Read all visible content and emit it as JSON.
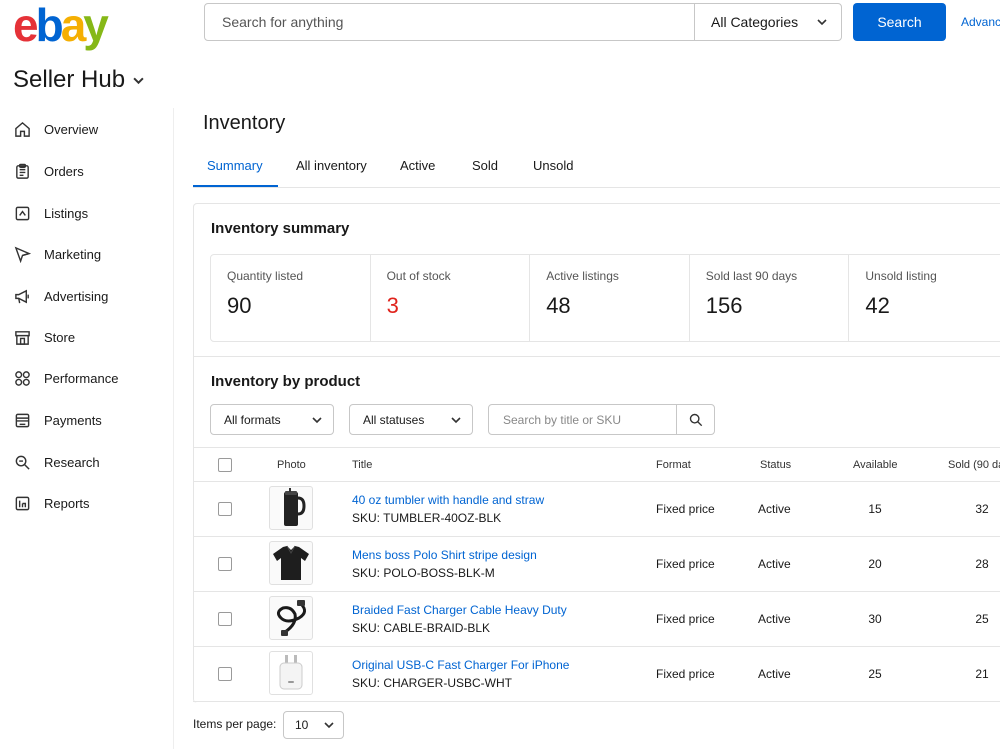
{
  "header": {
    "logo": [
      "e",
      "b",
      "a",
      "y"
    ],
    "search_placeholder": "Search for anything",
    "category": "All Categories",
    "search_button": "Search",
    "advanced": "Advanc"
  },
  "hub": {
    "title": "Seller Hub"
  },
  "sidebar": {
    "items": [
      {
        "label": "Overview",
        "icon": "home-icon"
      },
      {
        "label": "Orders",
        "icon": "clipboard-icon"
      },
      {
        "label": "Listings",
        "icon": "listings-icon"
      },
      {
        "label": "Marketing",
        "icon": "send-icon"
      },
      {
        "label": "Advertising",
        "icon": "megaphone-icon"
      },
      {
        "label": "Store",
        "icon": "store-icon"
      },
      {
        "label": "Performance",
        "icon": "grid-icon"
      },
      {
        "label": "Payments",
        "icon": "payments-icon"
      },
      {
        "label": "Research",
        "icon": "magnifier-icon"
      },
      {
        "label": "Reports",
        "icon": "reports-icon"
      }
    ]
  },
  "page": {
    "title": "Inventory"
  },
  "tabs": [
    "Summary",
    "All inventory",
    "Active",
    "Sold",
    "Unsold"
  ],
  "summary": {
    "title": "Inventory summary",
    "stats": [
      {
        "label": "Quantity listed",
        "value": "90"
      },
      {
        "label": "Out of stock",
        "value": "3"
      },
      {
        "label": "Active listings",
        "value": "48"
      },
      {
        "label": "Sold last 90 days",
        "value": "156"
      },
      {
        "label": "Unsold listing",
        "value": "42"
      }
    ]
  },
  "by_product": {
    "title": "Inventory by product",
    "format_filter": "All formats",
    "status_filter": "All statuses",
    "search_placeholder": "Search by title or SKU"
  },
  "table": {
    "headers": [
      "Photo",
      "Title",
      "Format",
      "Status",
      "Available",
      "Sold (90 da"
    ],
    "rows": [
      {
        "title": "40 oz tumbler with handle and straw",
        "sku": "SKU: TUMBLER-40OZ-BLK",
        "format": "Fixed price",
        "status": "Active",
        "available": "15",
        "sold": "32",
        "photo": "tumbler-photo"
      },
      {
        "title": "Mens boss Polo Shirt stripe design",
        "sku": "SKU: POLO-BOSS-BLK-M",
        "format": "Fixed price",
        "status": "Active",
        "available": "20",
        "sold": "28",
        "photo": "polo-shirt-photo"
      },
      {
        "title": "Braided Fast Charger Cable Heavy Duty",
        "sku": "SKU: CABLE-BRAID-BLK",
        "format": "Fixed price",
        "status": "Active",
        "available": "30",
        "sold": "25",
        "photo": "cable-photo"
      },
      {
        "title": "Original USB-C Fast Charger For iPhone",
        "sku": "SKU: CHARGER-USBC-WHT",
        "format": "Fixed price",
        "status": "Active",
        "available": "25",
        "sold": "21",
        "photo": "charger-photo"
      }
    ]
  },
  "pagination": {
    "label": "Items per page:",
    "value": "10"
  },
  "colors": {
    "accent": "#0064d2",
    "alert": "#e0231c"
  }
}
